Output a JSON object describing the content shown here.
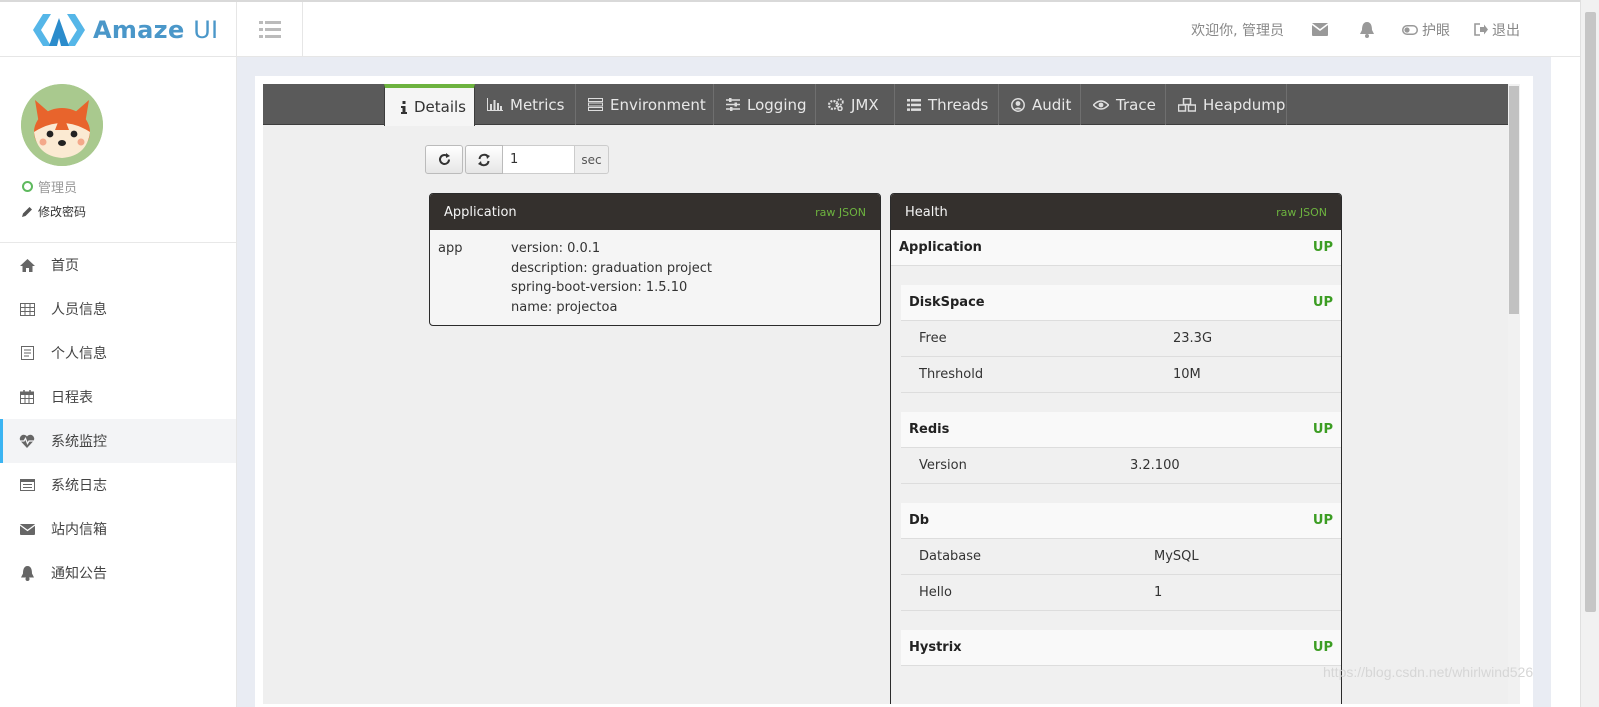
{
  "header": {
    "logo_text": "Amaze",
    "logo_suffix": "UI",
    "welcome": "欢迎你, 管理员",
    "eye_care": "护眼",
    "logout": "退出"
  },
  "profile": {
    "name": "管理员",
    "change_password": "修改密码"
  },
  "sidebar": {
    "items": [
      {
        "label": "首页",
        "icon": "home-icon"
      },
      {
        "label": "人员信息",
        "icon": "table-icon"
      },
      {
        "label": "个人信息",
        "icon": "contact-icon"
      },
      {
        "label": "日程表",
        "icon": "calendar-icon"
      },
      {
        "label": "系统监控",
        "icon": "heartbeat-icon",
        "active": true
      },
      {
        "label": "系统日志",
        "icon": "list-icon"
      },
      {
        "label": "站内信箱",
        "icon": "mail-icon"
      },
      {
        "label": "通知公告",
        "icon": "bell-icon"
      }
    ]
  },
  "tabs": [
    {
      "label": "Details",
      "icon": "info-icon",
      "active": true
    },
    {
      "label": "Metrics",
      "icon": "bar-chart-icon"
    },
    {
      "label": "Environment",
      "icon": "server-icon"
    },
    {
      "label": "Logging",
      "icon": "sliders-icon"
    },
    {
      "label": "JMX",
      "icon": "cogs-icon"
    },
    {
      "label": "Threads",
      "icon": "list-icon"
    },
    {
      "label": "Audit",
      "icon": "user-circle-icon"
    },
    {
      "label": "Trace",
      "icon": "eye-icon"
    },
    {
      "label": "Heapdump",
      "icon": "cubes-icon"
    }
  ],
  "refresh": {
    "interval_value": "1",
    "unit": "sec"
  },
  "application": {
    "title": "Application",
    "raw": "raw JSON",
    "key": "app",
    "lines": [
      "version: 0.0.1",
      "description: graduation project",
      "spring-boot-version: 1.5.10",
      "name: projectoa"
    ]
  },
  "health": {
    "title": "Health",
    "raw": "raw JSON",
    "application": {
      "label": "Application",
      "status": "UP"
    },
    "diskspace": {
      "label": "DiskSpace",
      "status": "UP",
      "rows": [
        {
          "key": "Free",
          "value": "23.3G"
        },
        {
          "key": "Threshold",
          "value": "10M"
        }
      ]
    },
    "redis": {
      "label": "Redis",
      "status": "UP",
      "rows": [
        {
          "key": "Version",
          "value": "3.2.100"
        }
      ]
    },
    "db": {
      "label": "Db",
      "status": "UP",
      "rows": [
        {
          "key": "Database",
          "value": "MySQL"
        },
        {
          "key": "Hello",
          "value": "1"
        }
      ]
    },
    "hystrix": {
      "label": "Hystrix",
      "status": "UP"
    }
  },
  "watermark": "https://blog.csdn.net/whirlwind526",
  "colors": {
    "accent": "#3bb4f2",
    "spring_green": "#6db33f",
    "status_up": "#3c9d23",
    "card_header": "#34302d",
    "tabbar": "#5a5a5a"
  }
}
